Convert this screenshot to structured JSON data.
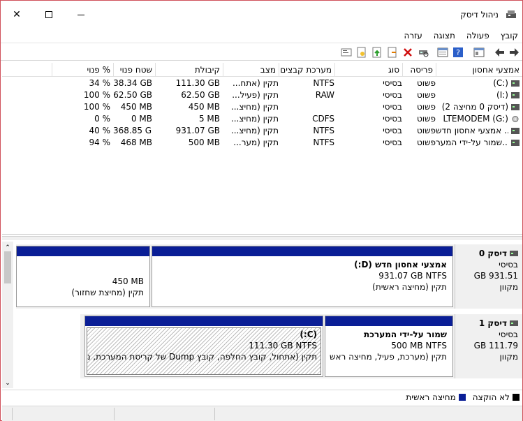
{
  "window": {
    "title": "ניהול דיסק"
  },
  "menu": [
    "קובץ",
    "פעולה",
    "תצוגה",
    "עזרה"
  ],
  "columns": [
    "אמצעי אחסון",
    "פריסה",
    "סוג",
    "מערכת קבצים",
    "מצב",
    "קיבולת",
    "שטח פנוי",
    "% פנוי"
  ],
  "volumes": [
    {
      "name": "(C:)",
      "layout": "פשוט",
      "type": "בסיסי",
      "fs": "NTFS",
      "status": "תקין (אתח...",
      "capacity": "111.30 GB",
      "free": "38.34 GB",
      "pct": "34 %"
    },
    {
      "name": "(I:)",
      "layout": "פשוט",
      "type": "בסיסי",
      "fs": "RAW",
      "status": "תקין (פעיל...",
      "capacity": "62.50 GB",
      "free": "62.50 GB",
      "pct": "100 %"
    },
    {
      "name": "(דיסק 0 מחיצה 2)",
      "layout": "פשוט",
      "type": "בסיסי",
      "fs": "",
      "status": "תקין (מחיצ...",
      "capacity": "450 MB",
      "free": "450 MB",
      "pct": "100 %"
    },
    {
      "name": "LTEMODEM (G:)",
      "layout": "פשוט",
      "type": "בסיסי",
      "fs": "CDFS",
      "status": "תקין (מחיצ...",
      "capacity": "5 MB",
      "free": "0 MB",
      "pct": "0 %"
    },
    {
      "name": "אמצעי אחסון חדש ...",
      "layout": "פשוט",
      "type": "בסיסי",
      "fs": "NTFS",
      "status": "תקין (מחיצ...",
      "capacity": "931.07 GB",
      "free": "368.85 GB",
      "pct": "40 %"
    },
    {
      "name": "שמור על-ידי המער...",
      "layout": "פשוט",
      "type": "בסיסי",
      "fs": "NTFS",
      "status": "תקין (מער...",
      "capacity": "500 MB",
      "free": "468 MB",
      "pct": "94 %"
    }
  ],
  "disks": [
    {
      "label": "דיסק 0",
      "kind": "בסיסי",
      "size": "931.51 GB",
      "state": "מקוון",
      "partitions": [
        {
          "name": "אמצעי אחסון חדש  (D:)",
          "detail": "931.07 GB NTFS",
          "status": "תקין (מחיצה ראשית)"
        },
        {
          "name": "",
          "detail": "450 MB",
          "status": "תקין (מחיצת שחזור)"
        }
      ]
    },
    {
      "label": "דיסק 1",
      "kind": "בסיסי",
      "size": "111.79 GB",
      "state": "מקוון",
      "partitions": [
        {
          "name": "שמור על-ידי המערכת",
          "detail": "500 MB NTFS",
          "status": "תקין (מערכת, פעיל, מחיצה ראש"
        },
        {
          "name": "(C:)",
          "detail": "111.30 GB NTFS",
          "status": "תקין (אתחול, קובץ החלפה, קובץ Dump של קריסת המערכת, מח"
        }
      ]
    }
  ],
  "legend": {
    "unallocated": "לא הוקצה",
    "primary": "מחיצה ראשית"
  },
  "colors": {
    "accent": "#d0505a",
    "primary_partition": "#0a1e96",
    "unallocated": "#000000"
  }
}
